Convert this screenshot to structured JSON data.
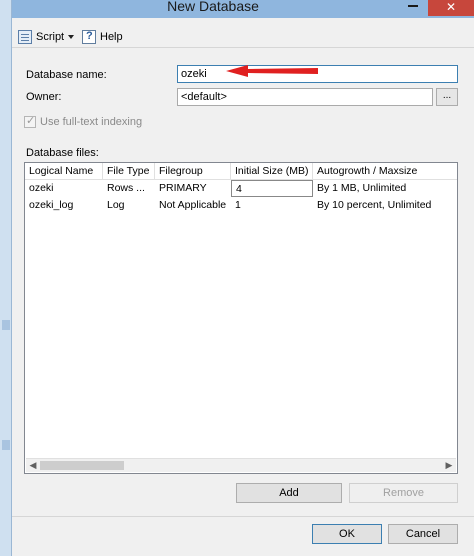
{
  "window": {
    "title": "New Database",
    "close_glyph": "✕"
  },
  "toolbar": {
    "script_label": "Script",
    "help_label": "Help"
  },
  "form": {
    "database_name_label": "Database name:",
    "database_name_value": "ozeki",
    "owner_label": "Owner:",
    "owner_value": "<default>",
    "browse_label": "...",
    "fulltext_label": "Use full-text indexing"
  },
  "files": {
    "label": "Database files:",
    "columns": [
      "Logical Name",
      "File Type",
      "Filegroup",
      "Initial Size (MB)",
      "Autogrowth / Maxsize"
    ],
    "rows": [
      [
        "ozeki",
        "Rows ...",
        "PRIMARY",
        "4",
        "By 1 MB, Unlimited"
      ],
      [
        "ozeki_log",
        "Log",
        "Not Applicable",
        "1",
        "By 10 percent, Unlimited"
      ]
    ]
  },
  "buttons": {
    "add": "Add",
    "remove": "Remove",
    "ok": "OK",
    "cancel": "Cancel"
  },
  "colors": {
    "arrow": "#e02020",
    "title_bar": "#8fb6de",
    "close": "#c7473c"
  }
}
